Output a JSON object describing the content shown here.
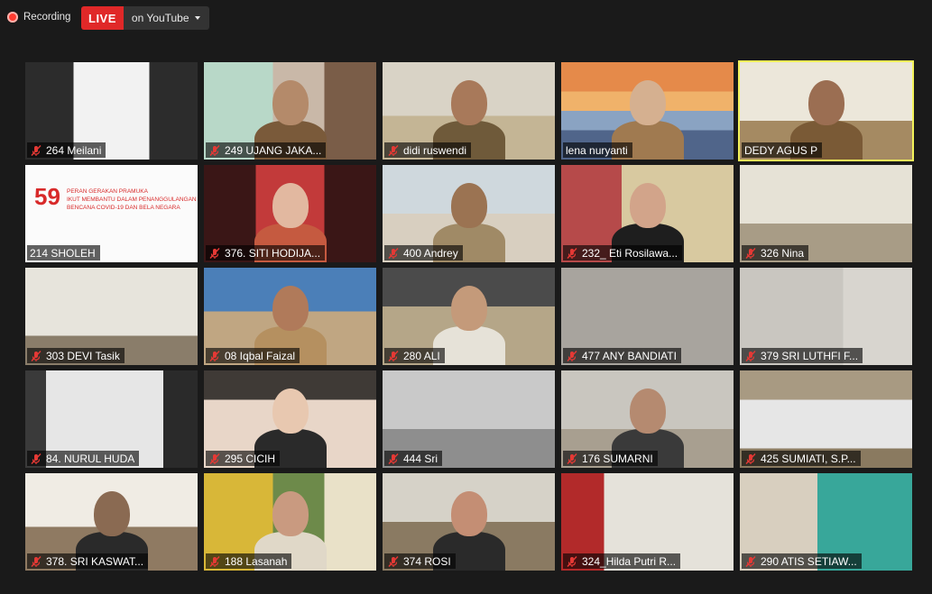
{
  "recording": {
    "label": "Recording"
  },
  "stream": {
    "live_label": "LIVE",
    "destination": "on YouTube"
  },
  "colors": {
    "live": "#e02828",
    "active_speaker_border": "#f3f35a",
    "muted_icon": "#e53935"
  },
  "participants": [
    {
      "name": "264 Meilani",
      "muted": true,
      "active": false
    },
    {
      "name": "249 UJANG JAKA...",
      "muted": true,
      "active": false
    },
    {
      "name": "didi ruswendi",
      "muted": true,
      "active": false
    },
    {
      "name": "lena nuryanti",
      "muted": false,
      "active": false
    },
    {
      "name": "DEDY AGUS P",
      "muted": false,
      "active": true
    },
    {
      "name": "214 SHOLEH",
      "muted": false,
      "active": false
    },
    {
      "name": "376. SITI HODIJA...",
      "muted": true,
      "active": false
    },
    {
      "name": "400 Andrey",
      "muted": true,
      "active": false
    },
    {
      "name": "232_ Eti Rosilawa...",
      "muted": true,
      "active": false
    },
    {
      "name": "326 Nina",
      "muted": true,
      "active": false
    },
    {
      "name": "303 DEVI Tasik",
      "muted": true,
      "active": false
    },
    {
      "name": "08 Iqbal Faizal",
      "muted": true,
      "active": false
    },
    {
      "name": "280 ALI",
      "muted": true,
      "active": false
    },
    {
      "name": "477 ANY BANDIATI",
      "muted": true,
      "active": false
    },
    {
      "name": "379 SRI LUTHFI F...",
      "muted": true,
      "active": false
    },
    {
      "name": "84. NURUL HUDA",
      "muted": true,
      "active": false
    },
    {
      "name": "295 CICIH",
      "muted": true,
      "active": false
    },
    {
      "name": "444 Sri",
      "muted": true,
      "active": false
    },
    {
      "name": "176 SUMARNI",
      "muted": true,
      "active": false
    },
    {
      "name": "425 SUMIATI, S.P...",
      "muted": true,
      "active": false
    },
    {
      "name": "378. SRI KASWAT...",
      "muted": true,
      "active": false
    },
    {
      "name": "188 Lasanah",
      "muted": true,
      "active": false
    },
    {
      "name": "374 ROSI",
      "muted": true,
      "active": false
    },
    {
      "name": "324_Hilda Putri R...",
      "muted": true,
      "active": false
    },
    {
      "name": "290 ATIS SETIAW...",
      "muted": true,
      "active": false
    }
  ],
  "banner": {
    "number": "59",
    "line1": "PERAN GERAKAN PRAMUKA",
    "line2": "IKUT MEMBANTU DALAM PENANGGULANGAN",
    "line3": "BENCANA COVID-19 DAN BELA NEGARA"
  }
}
